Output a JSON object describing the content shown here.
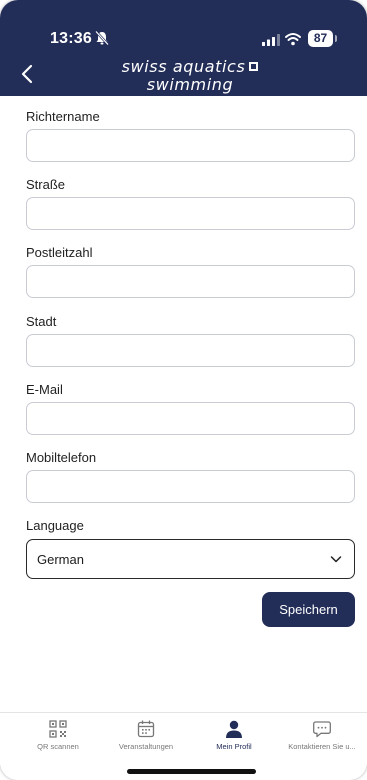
{
  "status_bar": {
    "time": "13:36",
    "battery": "87"
  },
  "header": {
    "brand_line1": "swiss aquatics",
    "brand_line2": "swimming",
    "brand_color": "#222d58"
  },
  "form": {
    "fields": [
      {
        "label": "Richtername",
        "value": ""
      },
      {
        "label": "Straße",
        "value": ""
      },
      {
        "label": "Postleitzahl",
        "value": ""
      },
      {
        "label": "Stadt",
        "value": ""
      },
      {
        "label": "E-Mail",
        "value": ""
      },
      {
        "label": "Mobiltelefon",
        "value": ""
      }
    ],
    "language_label": "Language",
    "language_value": "German",
    "save_label": "Speichern"
  },
  "tabbar": {
    "items": [
      {
        "label": "QR scannen",
        "icon": "qr-code-icon"
      },
      {
        "label": "Veranstaltungen",
        "icon": "calendar-icon"
      },
      {
        "label": "Mein Profil",
        "icon": "person-icon",
        "active": true
      },
      {
        "label": "Kontaktieren Sie u...",
        "icon": "chat-icon"
      }
    ]
  }
}
